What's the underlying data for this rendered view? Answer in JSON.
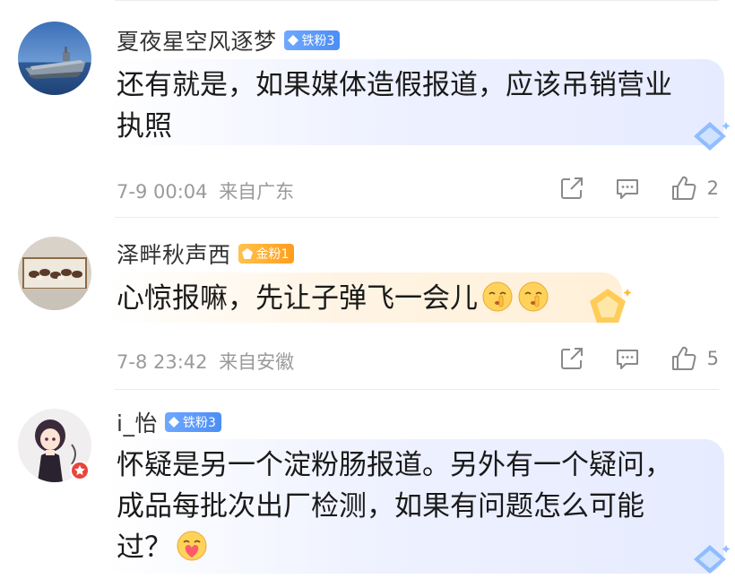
{
  "comments": [
    {
      "username": "夏夜星空风逐梦",
      "badge": "铁粉3",
      "badge_type": "iron",
      "text_lines": [
        "还有就是，如果媒体造假报道，应该吊销营业",
        "执照"
      ],
      "timestamp": "7-9 00:04",
      "location": "来自广东",
      "likes": "2",
      "avatar_icon": "aircraft-carrier-avatar"
    },
    {
      "username": "泽畔秋声西",
      "badge": "金粉1",
      "badge_type": "gold",
      "text_lines": [
        "心惊报嘛，先让子弹飞一会儿"
      ],
      "emojis": [
        "shush-emoji",
        "shush-emoji"
      ],
      "timestamp": "7-8 23:42",
      "location": "来自安徽",
      "likes": "5",
      "avatar_icon": "horses-painting-avatar"
    },
    {
      "username": "i_怡",
      "badge": "铁粉3",
      "badge_type": "iron",
      "text_lines": [
        "怀疑是另一个淀粉肠报道。另外有一个疑问，",
        "成品每批次出厂检测，如果有问题怎么可能",
        "过？"
      ],
      "emojis": [
        "heart-face-emoji"
      ],
      "avatar_icon": "anime-girl-avatar"
    }
  ],
  "colors": {
    "iron_badge": "#4b8ef5",
    "gold_badge": "#ff9d1c",
    "meta_text": "#9a9a9a",
    "bubble_blue": "#eef1ff",
    "bubble_gold": "#fff4e4"
  }
}
